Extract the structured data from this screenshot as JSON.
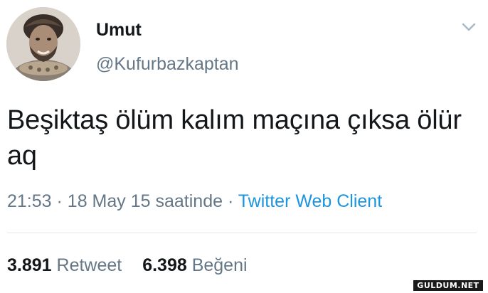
{
  "user": {
    "display_name": "Umut",
    "handle": "@Kufurbazkaptan"
  },
  "tweet": {
    "text": "Beşiktaş ölüm kalım maçına çıksa ölür aq",
    "time": "21:53",
    "date": "18 May 15 saatinde",
    "separator": "·",
    "source": "Twitter Web Client"
  },
  "stats": {
    "retweet_count": "3.891",
    "retweet_label": "Retweet",
    "like_count": "6.398",
    "like_label": "Beğeni"
  },
  "icons": {
    "more": "chevron-down-icon",
    "avatar": "avatar"
  },
  "watermark": "GULDUM.NET",
  "colors": {
    "text": "#14171a",
    "secondary": "#657786",
    "link": "#1b95e0",
    "divider": "#e1e8ed"
  }
}
